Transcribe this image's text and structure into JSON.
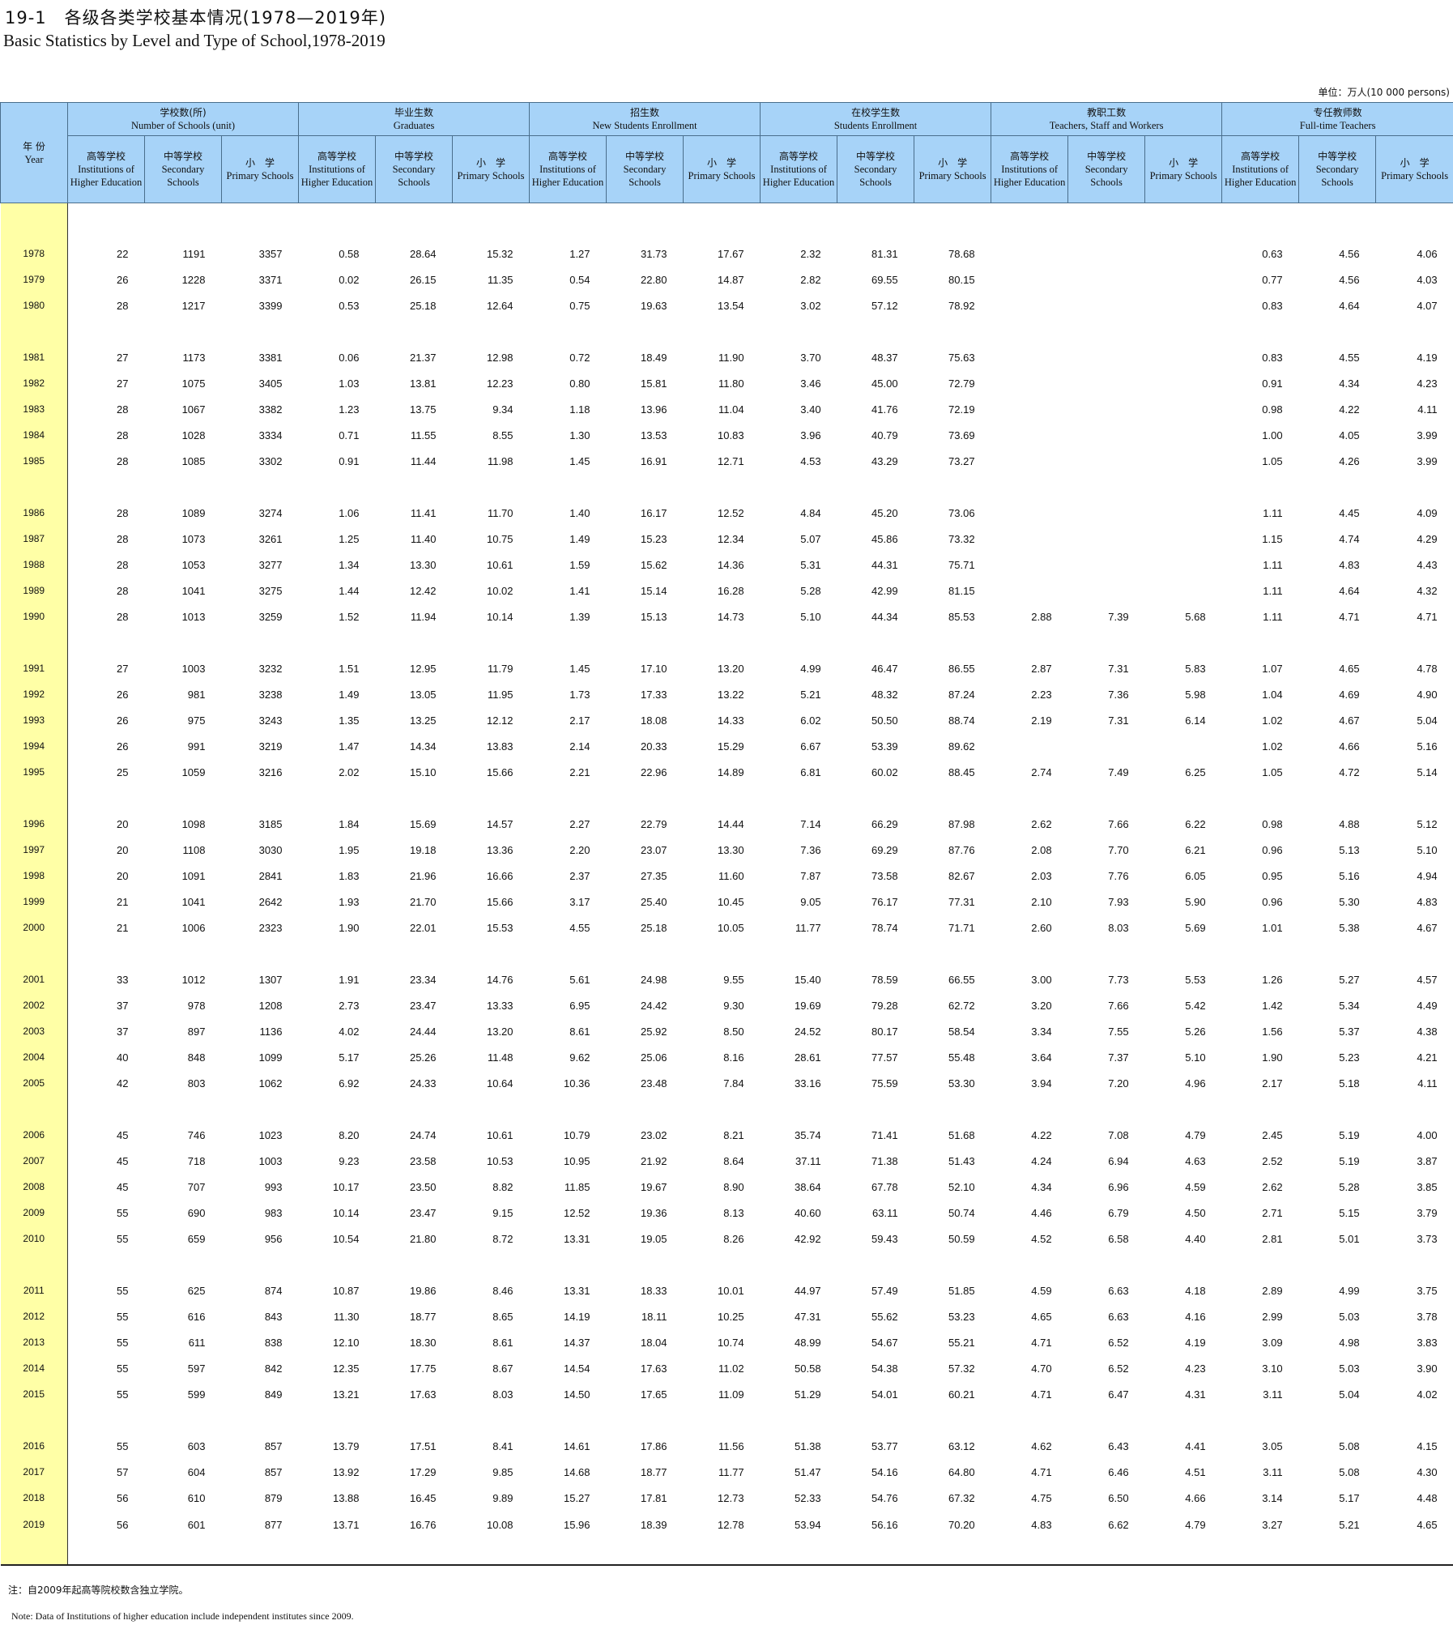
{
  "title_cn": "19-1　各级各类学校基本情况(1978—2019年)",
  "title_en": "Basic Statistics by Level and Type of School,1978-2019",
  "unit": "单位：万人(10 000 persons)",
  "header": {
    "year_cn": "年 份",
    "year_en": "Year",
    "groups": [
      {
        "cn": "学校数(所)",
        "en": "Number of Schools (unit)"
      },
      {
        "cn": "毕业生数",
        "en": "Graduates"
      },
      {
        "cn": "招生数",
        "en": "New Students Enrollment"
      },
      {
        "cn": "在校学生数",
        "en": "Students Enrollment"
      },
      {
        "cn": "教职工数",
        "en": "Teachers, Staff and Workers"
      },
      {
        "cn": "专任教师数",
        "en": "Full-time Teachers"
      }
    ],
    "sub": [
      {
        "cn": "高等学校",
        "en": "Institutions of Higher Education"
      },
      {
        "cn": "中等学校",
        "en": "Secondary Schools"
      },
      {
        "cn": "小　学",
        "en": "Primary Schools"
      }
    ]
  },
  "rows": [
    {
      "year": "1978",
      "v": [
        "22",
        "1191",
        "3357",
        "0.58",
        "28.64",
        "15.32",
        "1.27",
        "31.73",
        "17.67",
        "2.32",
        "81.31",
        "78.68",
        "",
        "",
        "",
        "0.63",
        "4.56",
        "4.06"
      ]
    },
    {
      "year": "1979",
      "v": [
        "26",
        "1228",
        "3371",
        "0.02",
        "26.15",
        "11.35",
        "0.54",
        "22.80",
        "14.87",
        "2.82",
        "69.55",
        "80.15",
        "",
        "",
        "",
        "0.77",
        "4.56",
        "4.03"
      ]
    },
    {
      "year": "1980",
      "v": [
        "28",
        "1217",
        "3399",
        "0.53",
        "25.18",
        "12.64",
        "0.75",
        "19.63",
        "13.54",
        "3.02",
        "57.12",
        "78.92",
        "",
        "",
        "",
        "0.83",
        "4.64",
        "4.07"
      ]
    },
    {
      "year": "1981",
      "v": [
        "27",
        "1173",
        "3381",
        "0.06",
        "21.37",
        "12.98",
        "0.72",
        "18.49",
        "11.90",
        "3.70",
        "48.37",
        "75.63",
        "",
        "",
        "",
        "0.83",
        "4.55",
        "4.19"
      ]
    },
    {
      "year": "1982",
      "v": [
        "27",
        "1075",
        "3405",
        "1.03",
        "13.81",
        "12.23",
        "0.80",
        "15.81",
        "11.80",
        "3.46",
        "45.00",
        "72.79",
        "",
        "",
        "",
        "0.91",
        "4.34",
        "4.23"
      ]
    },
    {
      "year": "1983",
      "v": [
        "28",
        "1067",
        "3382",
        "1.23",
        "13.75",
        "9.34",
        "1.18",
        "13.96",
        "11.04",
        "3.40",
        "41.76",
        "72.19",
        "",
        "",
        "",
        "0.98",
        "4.22",
        "4.11"
      ]
    },
    {
      "year": "1984",
      "v": [
        "28",
        "1028",
        "3334",
        "0.71",
        "11.55",
        "8.55",
        "1.30",
        "13.53",
        "10.83",
        "3.96",
        "40.79",
        "73.69",
        "",
        "",
        "",
        "1.00",
        "4.05",
        "3.99"
      ]
    },
    {
      "year": "1985",
      "v": [
        "28",
        "1085",
        "3302",
        "0.91",
        "11.44",
        "11.98",
        "1.45",
        "16.91",
        "12.71",
        "4.53",
        "43.29",
        "73.27",
        "",
        "",
        "",
        "1.05",
        "4.26",
        "3.99"
      ]
    },
    {
      "year": "1986",
      "v": [
        "28",
        "1089",
        "3274",
        "1.06",
        "11.41",
        "11.70",
        "1.40",
        "16.17",
        "12.52",
        "4.84",
        "45.20",
        "73.06",
        "",
        "",
        "",
        "1.11",
        "4.45",
        "4.09"
      ]
    },
    {
      "year": "1987",
      "v": [
        "28",
        "1073",
        "3261",
        "1.25",
        "11.40",
        "10.75",
        "1.49",
        "15.23",
        "12.34",
        "5.07",
        "45.86",
        "73.32",
        "",
        "",
        "",
        "1.15",
        "4.74",
        "4.29"
      ]
    },
    {
      "year": "1988",
      "v": [
        "28",
        "1053",
        "3277",
        "1.34",
        "13.30",
        "10.61",
        "1.59",
        "15.62",
        "14.36",
        "5.31",
        "44.31",
        "75.71",
        "",
        "",
        "",
        "1.11",
        "4.83",
        "4.43"
      ]
    },
    {
      "year": "1989",
      "v": [
        "28",
        "1041",
        "3275",
        "1.44",
        "12.42",
        "10.02",
        "1.41",
        "15.14",
        "16.28",
        "5.28",
        "42.99",
        "81.15",
        "",
        "",
        "",
        "1.11",
        "4.64",
        "4.32"
      ]
    },
    {
      "year": "1990",
      "v": [
        "28",
        "1013",
        "3259",
        "1.52",
        "11.94",
        "10.14",
        "1.39",
        "15.13",
        "14.73",
        "5.10",
        "44.34",
        "85.53",
        "2.88",
        "7.39",
        "5.68",
        "1.11",
        "4.71",
        "4.71"
      ]
    },
    {
      "year": "1991",
      "v": [
        "27",
        "1003",
        "3232",
        "1.51",
        "12.95",
        "11.79",
        "1.45",
        "17.10",
        "13.20",
        "4.99",
        "46.47",
        "86.55",
        "2.87",
        "7.31",
        "5.83",
        "1.07",
        "4.65",
        "4.78"
      ]
    },
    {
      "year": "1992",
      "v": [
        "26",
        "981",
        "3238",
        "1.49",
        "13.05",
        "11.95",
        "1.73",
        "17.33",
        "13.22",
        "5.21",
        "48.32",
        "87.24",
        "2.23",
        "7.36",
        "5.98",
        "1.04",
        "4.69",
        "4.90"
      ]
    },
    {
      "year": "1993",
      "v": [
        "26",
        "975",
        "3243",
        "1.35",
        "13.25",
        "12.12",
        "2.17",
        "18.08",
        "14.33",
        "6.02",
        "50.50",
        "88.74",
        "2.19",
        "7.31",
        "6.14",
        "1.02",
        "4.67",
        "5.04"
      ]
    },
    {
      "year": "1994",
      "v": [
        "26",
        "991",
        "3219",
        "1.47",
        "14.34",
        "13.83",
        "2.14",
        "20.33",
        "15.29",
        "6.67",
        "53.39",
        "89.62",
        "",
        "",
        "",
        "1.02",
        "4.66",
        "5.16"
      ]
    },
    {
      "year": "1995",
      "v": [
        "25",
        "1059",
        "3216",
        "2.02",
        "15.10",
        "15.66",
        "2.21",
        "22.96",
        "14.89",
        "6.81",
        "60.02",
        "88.45",
        "2.74",
        "7.49",
        "6.25",
        "1.05",
        "4.72",
        "5.14"
      ]
    },
    {
      "year": "1996",
      "v": [
        "20",
        "1098",
        "3185",
        "1.84",
        "15.69",
        "14.57",
        "2.27",
        "22.79",
        "14.44",
        "7.14",
        "66.29",
        "87.98",
        "2.62",
        "7.66",
        "6.22",
        "0.98",
        "4.88",
        "5.12"
      ]
    },
    {
      "year": "1997",
      "v": [
        "20",
        "1108",
        "3030",
        "1.95",
        "19.18",
        "13.36",
        "2.20",
        "23.07",
        "13.30",
        "7.36",
        "69.29",
        "87.76",
        "2.08",
        "7.70",
        "6.21",
        "0.96",
        "5.13",
        "5.10"
      ]
    },
    {
      "year": "1998",
      "v": [
        "20",
        "1091",
        "2841",
        "1.83",
        "21.96",
        "16.66",
        "2.37",
        "27.35",
        "11.60",
        "7.87",
        "73.58",
        "82.67",
        "2.03",
        "7.76",
        "6.05",
        "0.95",
        "5.16",
        "4.94"
      ]
    },
    {
      "year": "1999",
      "v": [
        "21",
        "1041",
        "2642",
        "1.93",
        "21.70",
        "15.66",
        "3.17",
        "25.40",
        "10.45",
        "9.05",
        "76.17",
        "77.31",
        "2.10",
        "7.93",
        "5.90",
        "0.96",
        "5.30",
        "4.83"
      ]
    },
    {
      "year": "2000",
      "v": [
        "21",
        "1006",
        "2323",
        "1.90",
        "22.01",
        "15.53",
        "4.55",
        "25.18",
        "10.05",
        "11.77",
        "78.74",
        "71.71",
        "2.60",
        "8.03",
        "5.69",
        "1.01",
        "5.38",
        "4.67"
      ]
    },
    {
      "year": "2001",
      "v": [
        "33",
        "1012",
        "1307",
        "1.91",
        "23.34",
        "14.76",
        "5.61",
        "24.98",
        "9.55",
        "15.40",
        "78.59",
        "66.55",
        "3.00",
        "7.73",
        "5.53",
        "1.26",
        "5.27",
        "4.57"
      ]
    },
    {
      "year": "2002",
      "v": [
        "37",
        "978",
        "1208",
        "2.73",
        "23.47",
        "13.33",
        "6.95",
        "24.42",
        "9.30",
        "19.69",
        "79.28",
        "62.72",
        "3.20",
        "7.66",
        "5.42",
        "1.42",
        "5.34",
        "4.49"
      ]
    },
    {
      "year": "2003",
      "v": [
        "37",
        "897",
        "1136",
        "4.02",
        "24.44",
        "13.20",
        "8.61",
        "25.92",
        "8.50",
        "24.52",
        "80.17",
        "58.54",
        "3.34",
        "7.55",
        "5.26",
        "1.56",
        "5.37",
        "4.38"
      ]
    },
    {
      "year": "2004",
      "v": [
        "40",
        "848",
        "1099",
        "5.17",
        "25.26",
        "11.48",
        "9.62",
        "25.06",
        "8.16",
        "28.61",
        "77.57",
        "55.48",
        "3.64",
        "7.37",
        "5.10",
        "1.90",
        "5.23",
        "4.21"
      ]
    },
    {
      "year": "2005",
      "v": [
        "42",
        "803",
        "1062",
        "6.92",
        "24.33",
        "10.64",
        "10.36",
        "23.48",
        "7.84",
        "33.16",
        "75.59",
        "53.30",
        "3.94",
        "7.20",
        "4.96",
        "2.17",
        "5.18",
        "4.11"
      ]
    },
    {
      "year": "2006",
      "v": [
        "45",
        "746",
        "1023",
        "8.20",
        "24.74",
        "10.61",
        "10.79",
        "23.02",
        "8.21",
        "35.74",
        "71.41",
        "51.68",
        "4.22",
        "7.08",
        "4.79",
        "2.45",
        "5.19",
        "4.00"
      ]
    },
    {
      "year": "2007",
      "v": [
        "45",
        "718",
        "1003",
        "9.23",
        "23.58",
        "10.53",
        "10.95",
        "21.92",
        "8.64",
        "37.11",
        "71.38",
        "51.43",
        "4.24",
        "6.94",
        "4.63",
        "2.52",
        "5.19",
        "3.87"
      ]
    },
    {
      "year": "2008",
      "v": [
        "45",
        "707",
        "993",
        "10.17",
        "23.50",
        "8.82",
        "11.85",
        "19.67",
        "8.90",
        "38.64",
        "67.78",
        "52.10",
        "4.34",
        "6.96",
        "4.59",
        "2.62",
        "5.28",
        "3.85"
      ]
    },
    {
      "year": "2009",
      "v": [
        "55",
        "690",
        "983",
        "10.14",
        "23.47",
        "9.15",
        "12.52",
        "19.36",
        "8.13",
        "40.60",
        "63.11",
        "50.74",
        "4.46",
        "6.79",
        "4.50",
        "2.71",
        "5.15",
        "3.79"
      ]
    },
    {
      "year": "2010",
      "v": [
        "55",
        "659",
        "956",
        "10.54",
        "21.80",
        "8.72",
        "13.31",
        "19.05",
        "8.26",
        "42.92",
        "59.43",
        "50.59",
        "4.52",
        "6.58",
        "4.40",
        "2.81",
        "5.01",
        "3.73"
      ]
    },
    {
      "year": "2011",
      "v": [
        "55",
        "625",
        "874",
        "10.87",
        "19.86",
        "8.46",
        "13.31",
        "18.33",
        "10.01",
        "44.97",
        "57.49",
        "51.85",
        "4.59",
        "6.63",
        "4.18",
        "2.89",
        "4.99",
        "3.75"
      ]
    },
    {
      "year": "2012",
      "v": [
        "55",
        "616",
        "843",
        "11.30",
        "18.77",
        "8.65",
        "14.19",
        "18.11",
        "10.25",
        "47.31",
        "55.62",
        "53.23",
        "4.65",
        "6.63",
        "4.16",
        "2.99",
        "5.03",
        "3.78"
      ]
    },
    {
      "year": "2013",
      "v": [
        "55",
        "611",
        "838",
        "12.10",
        "18.30",
        "8.61",
        "14.37",
        "18.04",
        "10.74",
        "48.99",
        "54.67",
        "55.21",
        "4.71",
        "6.52",
        "4.19",
        "3.09",
        "4.98",
        "3.83"
      ]
    },
    {
      "year": "2014",
      "v": [
        "55",
        "597",
        "842",
        "12.35",
        "17.75",
        "8.67",
        "14.54",
        "17.63",
        "11.02",
        "50.58",
        "54.38",
        "57.32",
        "4.70",
        "6.52",
        "4.23",
        "3.10",
        "5.03",
        "3.90"
      ]
    },
    {
      "year": "2015",
      "v": [
        "55",
        "599",
        "849",
        "13.21",
        "17.63",
        "8.03",
        "14.50",
        "17.65",
        "11.09",
        "51.29",
        "54.01",
        "60.21",
        "4.71",
        "6.47",
        "4.31",
        "3.11",
        "5.04",
        "4.02"
      ]
    },
    {
      "year": "2016",
      "v": [
        "55",
        "603",
        "857",
        "13.79",
        "17.51",
        "8.41",
        "14.61",
        "17.86",
        "11.56",
        "51.38",
        "53.77",
        "63.12",
        "4.62",
        "6.43",
        "4.41",
        "3.05",
        "5.08",
        "4.15"
      ]
    },
    {
      "year": "2017",
      "v": [
        "57",
        "604",
        "857",
        "13.92",
        "17.29",
        "9.85",
        "14.68",
        "18.77",
        "11.77",
        "51.47",
        "54.16",
        "64.80",
        "4.71",
        "6.46",
        "4.51",
        "3.11",
        "5.08",
        "4.30"
      ]
    },
    {
      "year": "2018",
      "v": [
        "56",
        "610",
        "879",
        "13.88",
        "16.45",
        "9.89",
        "15.27",
        "17.81",
        "12.73",
        "52.33",
        "54.76",
        "67.32",
        "4.75",
        "6.50",
        "4.66",
        "3.14",
        "5.17",
        "4.48"
      ]
    },
    {
      "year": "2019",
      "v": [
        "56",
        "601",
        "877",
        "13.71",
        "16.76",
        "10.08",
        "15.96",
        "18.39",
        "12.78",
        "53.94",
        "56.16",
        "70.20",
        "4.83",
        "6.62",
        "4.79",
        "3.27",
        "5.21",
        "4.65"
      ]
    }
  ],
  "note_cn": "注：自2009年起高等院校数含独立学院。",
  "note_en": "Note: Data of Institutions of higher education include independent institutes since 2009."
}
